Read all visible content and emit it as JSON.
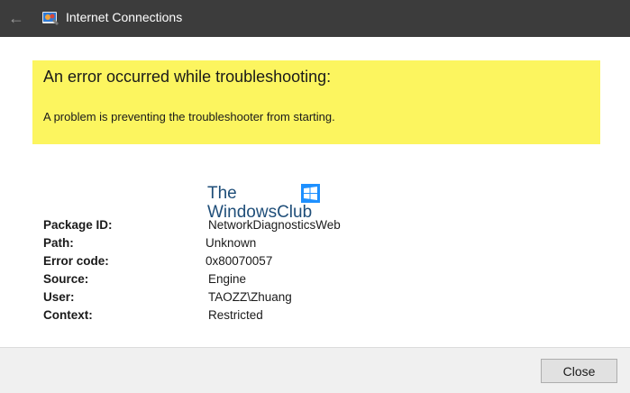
{
  "window": {
    "title": "Internet Connections",
    "back_icon": "back-arrow-icon",
    "app_icon": "troubleshooter-icon"
  },
  "error": {
    "heading": "An error occurred while troubleshooting:",
    "message": "A problem is preventing the troubleshooter from starting.",
    "banner_color": "#fcf55f"
  },
  "watermark": {
    "line1": "The",
    "line2": "WindowsClub",
    "logo_icon": "windows-logo-icon"
  },
  "details": [
    {
      "label": "Package ID:",
      "value": "NetworkDiagnosticsWeb"
    },
    {
      "label": "Path:",
      "value": "Unknown"
    },
    {
      "label": "Error code:",
      "value": "0x80070057"
    },
    {
      "label": "Source:",
      "value": "Engine"
    },
    {
      "label": "User:",
      "value": "TAOZZ\\Zhuang"
    },
    {
      "label": "Context:",
      "value": "Restricted"
    }
  ],
  "footer": {
    "close_label": "Close"
  }
}
